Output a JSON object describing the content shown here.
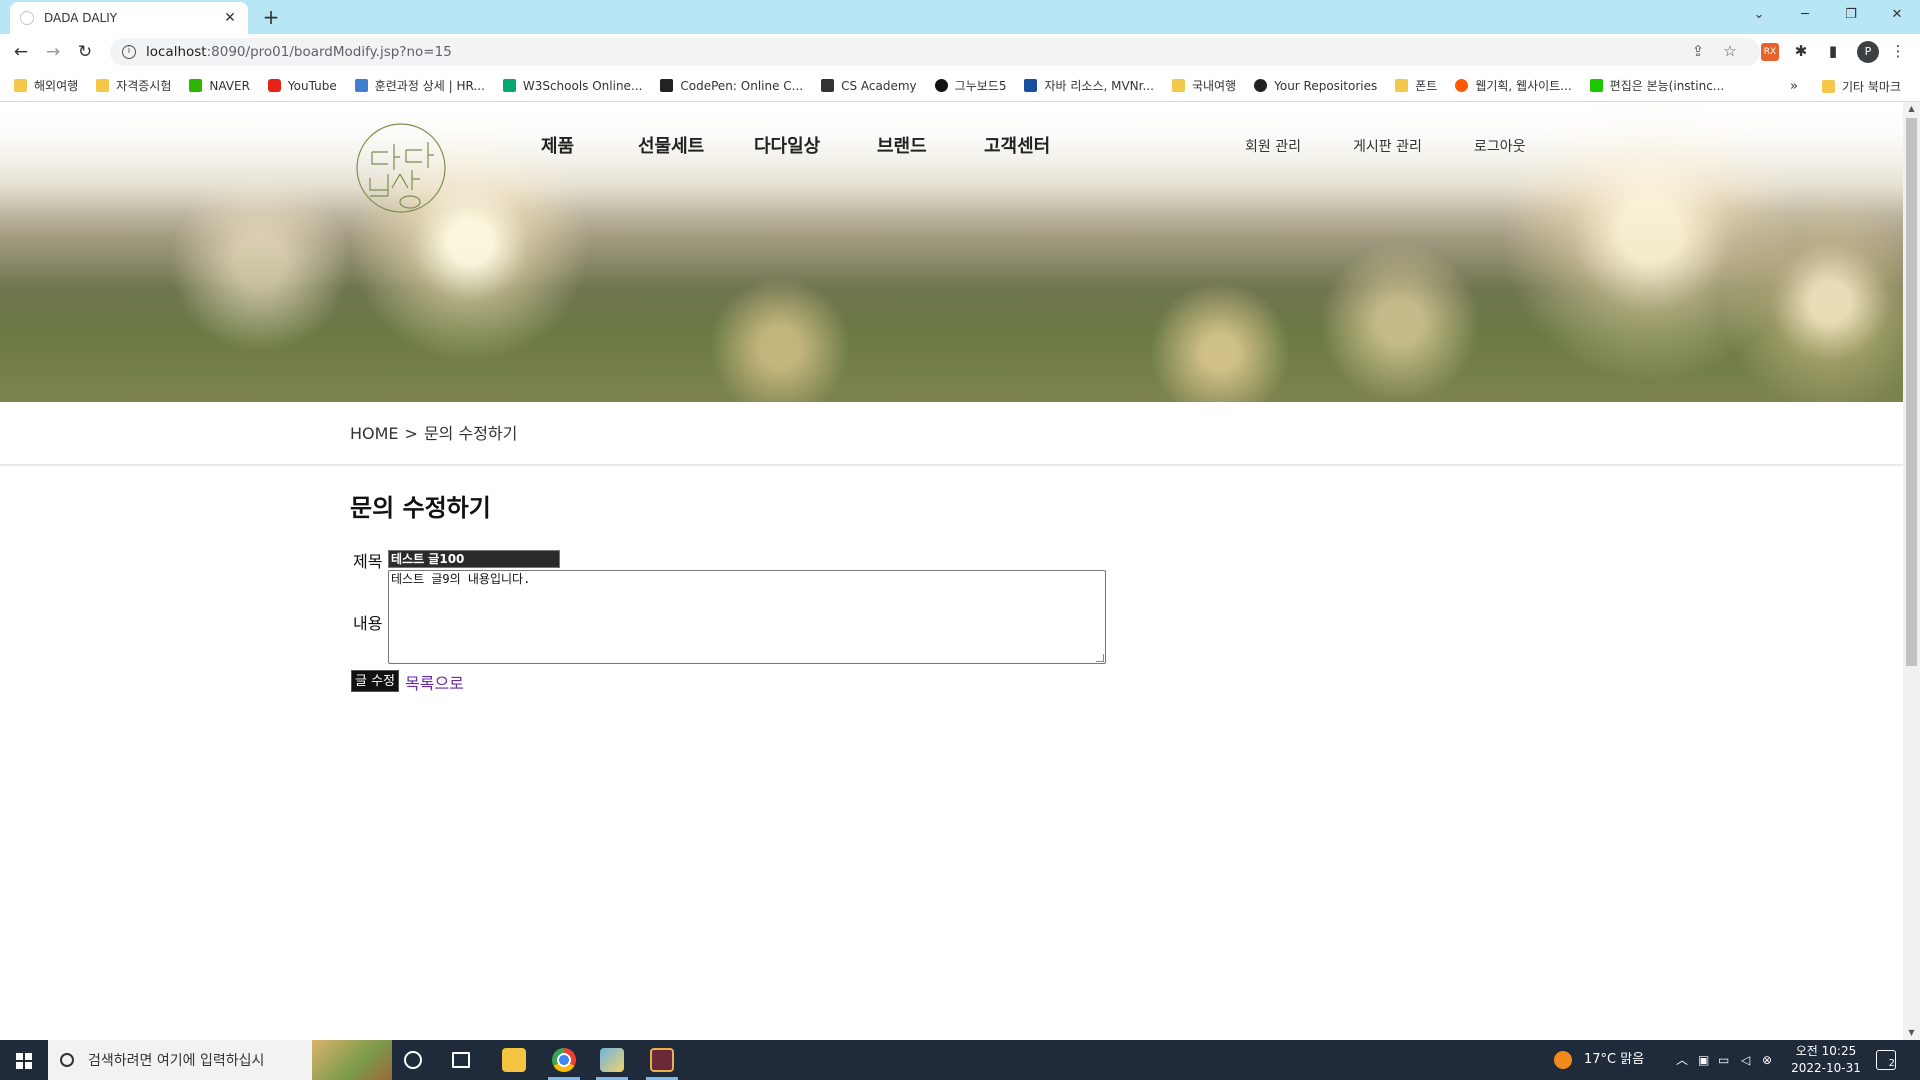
{
  "browser": {
    "tab_title": "DADA DALIY",
    "url_host": "localhost",
    "url_path": ":8090/pro01/boardModify.jsp?no=15",
    "profile_initial": "P",
    "bookmarks": [
      "해외여행",
      "자격증시험",
      "NAVER",
      "YouTube",
      "훈련과정 상세 | HR...",
      "W3Schools Online...",
      "CodePen: Online C...",
      "CS Academy",
      "그누보드5",
      "자바 리소스, MVNr...",
      "국내여행",
      "Your Repositories",
      "폰트",
      "웹기획, 웹사이트...",
      "편집은 본능(instinc..."
    ],
    "bookmarks_other": "기타 북마크",
    "bookmarks_more": "»",
    "ext_label": "RX"
  },
  "site": {
    "nav": [
      "제품",
      "선물세트",
      "다다일상",
      "브랜드",
      "고객센터"
    ],
    "util": [
      "회원 관리",
      "게시판 관리",
      "로그아웃"
    ],
    "logo_color": "#7a8f4e"
  },
  "breadcrumb": {
    "home": "HOME",
    "sep": ">",
    "current": "문의 수정하기"
  },
  "form": {
    "heading": "문의 수정하기",
    "title_label": "제목",
    "title_value": "테스트 글100",
    "content_label": "내용",
    "content_value": "테스트 글9의 내용입니다.",
    "submit_label": "글 수정",
    "list_link": "목록으로"
  },
  "taskbar": {
    "search_placeholder": "검색하려면 여기에 입력하십시",
    "weather": "17°C  맑음",
    "time": "오전 10:25",
    "date": "2022-10-31",
    "notifications": "2"
  }
}
